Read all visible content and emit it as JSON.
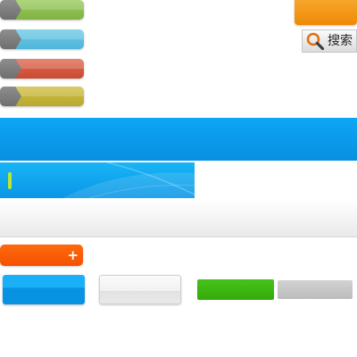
{
  "colors": {
    "pill_green": "#8fbf52",
    "pill_blue": "#5fc2e2",
    "pill_red": "#d75a43",
    "pill_olive": "#c7b63a",
    "pill_tab": "#7f7f7f",
    "orange_button": "#f29413",
    "header_blue": "#0a9de9",
    "banner_blue": "#12a6ee",
    "cursor_green": "#b8e832",
    "add_orange": "#ff5e00",
    "action_green": "#3db512",
    "disabled_gray": "#c6c6c6"
  },
  "icons": {
    "search": "magnifier-icon",
    "add": "plus-icon"
  },
  "search_button": {
    "label": "搜索"
  },
  "add_button": {
    "symbol": "+"
  }
}
